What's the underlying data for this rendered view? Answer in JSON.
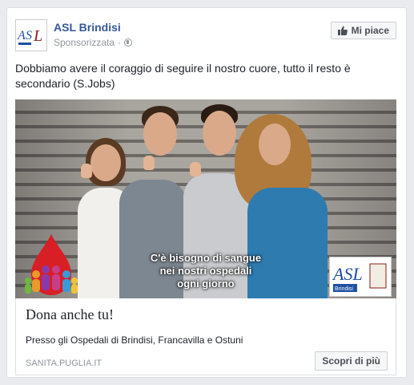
{
  "post": {
    "page_name": "ASL Brindisi",
    "sponsored_label": "Sponsorizzata",
    "separator": "·",
    "like_label": "Mi piace",
    "text": "Dobbiamo avere il coraggio di seguire il nostro cuore, tutto il resto è secondario (S.Jobs)"
  },
  "ad": {
    "caption_lines": [
      "C'è bisogno di sangue",
      "nei nostri ospedali",
      "ogni giorno"
    ],
    "logo_text": "ASL",
    "logo_subtext": "Brindisi",
    "headline": "Dona anche tu!",
    "description": "Presso gli Ospedali di Brindisi, Francavilla e Ostuni",
    "domain": "sanita.puglia.it",
    "cta_label": "Scopri di più"
  },
  "colors": {
    "link_blue": "#365899",
    "meta_gray": "#90949c",
    "drop_red": "#d81f26"
  }
}
